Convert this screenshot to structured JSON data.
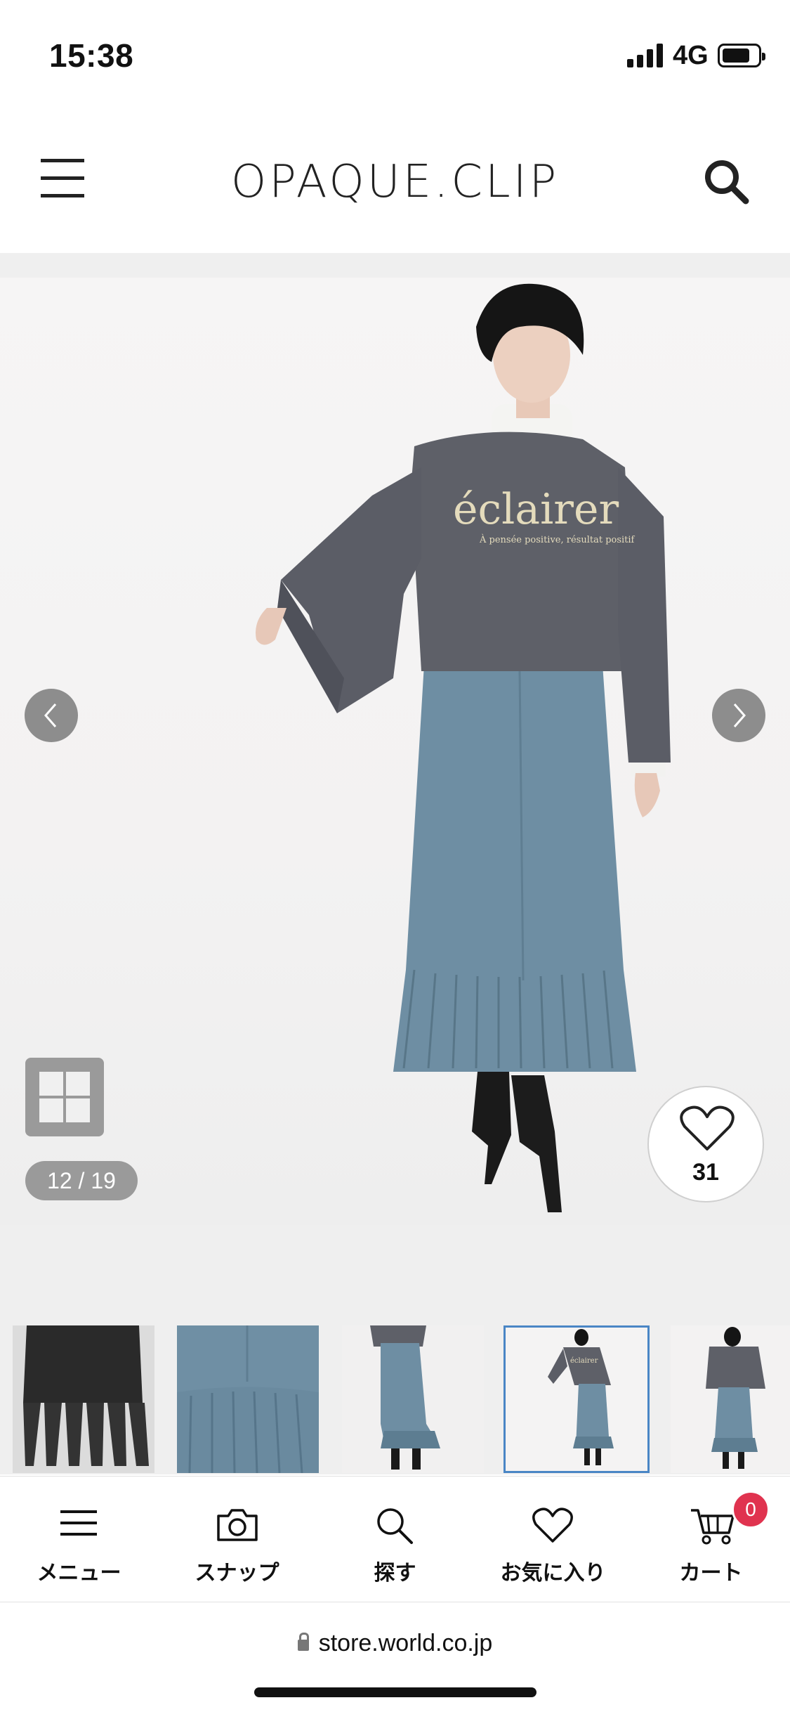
{
  "status_bar": {
    "time": "15:38",
    "network": "4G",
    "signal_icon": "signal-bars-icon",
    "battery_icon": "battery-icon"
  },
  "header": {
    "brand": "OPAQUE.CLIP",
    "menu_icon": "hamburger-menu-icon",
    "search_icon": "search-icon"
  },
  "gallery": {
    "sweatshirt_text": "éclairer",
    "sweatshirt_subtext": "À pensée positive, résultat positif",
    "page_counter": "12 / 19",
    "current_index": 12,
    "total": 19,
    "favorite_count": "31",
    "prev_icon": "chevron-left-icon",
    "next_icon": "chevron-right-icon",
    "grid_icon": "grid-view-icon",
    "heart_icon": "heart-icon"
  },
  "thumbnails": [
    {
      "desc": "black-pleated-hem"
    },
    {
      "desc": "blue-pleated-detail"
    },
    {
      "desc": "blue-skirt-back"
    },
    {
      "desc": "full-look-selected",
      "selected": true
    },
    {
      "desc": "full-look-back"
    }
  ],
  "tab_bar": {
    "items": [
      {
        "label": "メニュー",
        "icon": "menu-icon"
      },
      {
        "label": "スナップ",
        "icon": "camera-icon"
      },
      {
        "label": "探す",
        "icon": "search-icon"
      },
      {
        "label": "お気に入り",
        "icon": "heart-icon"
      },
      {
        "label": "カート",
        "icon": "cart-icon",
        "badge": "0"
      }
    ]
  },
  "browser": {
    "url": "store.world.co.jp"
  },
  "colors": {
    "accent_blue": "#4a86c5",
    "badge_red": "#e0334f",
    "skirt_blue": "#6e8ea3",
    "sweatshirt_gray": "#5e6068"
  }
}
